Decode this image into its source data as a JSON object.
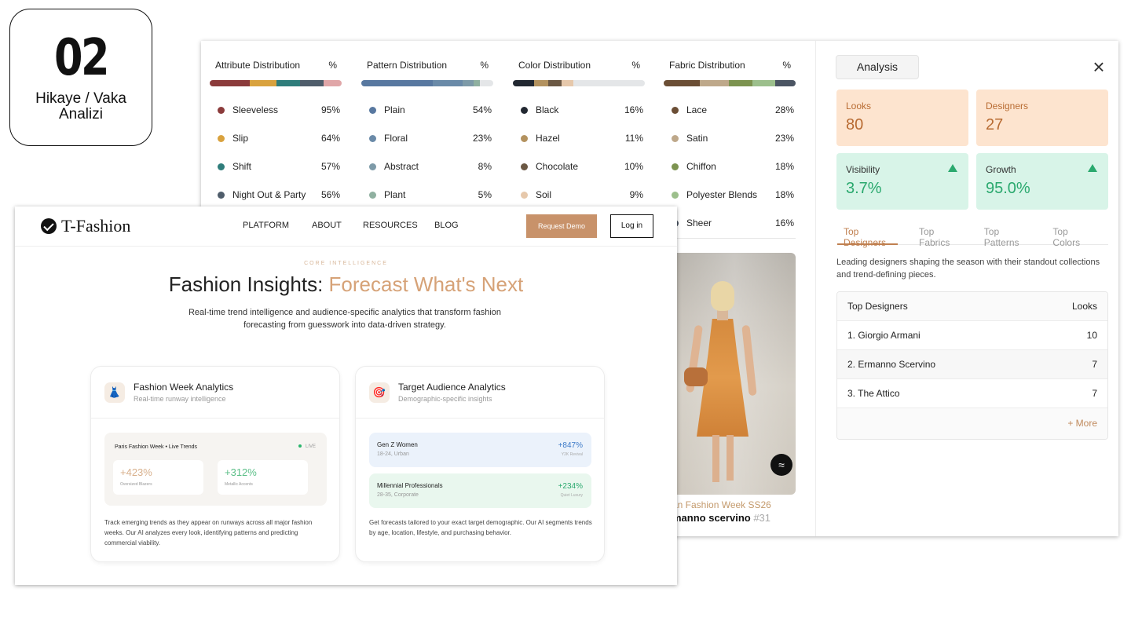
{
  "badge": {
    "number": "02",
    "subtitle_line1": "Hikaye / Vaka",
    "subtitle_line2": "Analizi"
  },
  "distributions": [
    {
      "title": "Attribute Distribution",
      "pct_header": "%",
      "bar": [
        {
          "color": "#8b3b3b",
          "value": 95
        },
        {
          "color": "#d9a23e",
          "value": 64
        },
        {
          "color": "#2f7d7b",
          "value": 57
        },
        {
          "color": "#4f5d6b",
          "value": 56
        },
        {
          "color": "#e0a6a8",
          "value": 44
        }
      ],
      "items": [
        {
          "label": "Sleeveless",
          "pct": "95%",
          "color": "#8b3b3b"
        },
        {
          "label": "Slip",
          "pct": "64%",
          "color": "#d9a23e"
        },
        {
          "label": "Shift",
          "pct": "57%",
          "color": "#2f7d7b"
        },
        {
          "label": "Night Out & Party",
          "pct": "56%",
          "color": "#4f5d6b"
        }
      ]
    },
    {
      "title": "Pattern Distribution",
      "pct_header": "%",
      "bar": [
        {
          "color": "#5878a0",
          "value": 54
        },
        {
          "color": "#6a8aa8",
          "value": 23
        },
        {
          "color": "#7d9aa8",
          "value": 8
        },
        {
          "color": "#8fb0a0",
          "value": 5
        },
        {
          "color": "#e4e6e8",
          "value": 10
        }
      ],
      "items": [
        {
          "label": "Plain",
          "pct": "54%",
          "color": "#5878a0"
        },
        {
          "label": "Floral",
          "pct": "23%",
          "color": "#6a8aa8"
        },
        {
          "label": "Abstract",
          "pct": "8%",
          "color": "#7d9aa8"
        },
        {
          "label": "Plant",
          "pct": "5%",
          "color": "#8fb0a0"
        }
      ]
    },
    {
      "title": "Color Distribution",
      "pct_header": "%",
      "bar": [
        {
          "color": "#222831",
          "value": 16
        },
        {
          "color": "#b3925f",
          "value": 11
        },
        {
          "color": "#6b5844",
          "value": 10
        },
        {
          "color": "#e6c8ab",
          "value": 9
        },
        {
          "color": "#e4e6e8",
          "value": 54
        }
      ],
      "items": [
        {
          "label": "Black",
          "pct": "16%",
          "color": "#222831"
        },
        {
          "label": "Hazel",
          "pct": "11%",
          "color": "#b3925f"
        },
        {
          "label": "Chocolate",
          "pct": "10%",
          "color": "#6b5844"
        },
        {
          "label": "Soil",
          "pct": "9%",
          "color": "#e6c8ab"
        }
      ]
    },
    {
      "title": "Fabric Distribution",
      "pct_header": "%",
      "bar": [
        {
          "color": "#6b4e35",
          "value": 28
        },
        {
          "color": "#bea88a",
          "value": 23
        },
        {
          "color": "#7c9350",
          "value": 18
        },
        {
          "color": "#9cbf8c",
          "value": 18
        },
        {
          "color": "#4b5563",
          "value": 16
        }
      ],
      "items": [
        {
          "label": "Lace",
          "pct": "28%",
          "color": "#6b4e35"
        },
        {
          "label": "Satin",
          "pct": "23%",
          "color": "#bea88a"
        },
        {
          "label": "Chiffon",
          "pct": "18%",
          "color": "#7c9350"
        },
        {
          "label": "Polyester Blends",
          "pct": "18%",
          "color": "#9cbf8c"
        },
        {
          "label": "Sheer",
          "pct": "16%",
          "color": "#4b5563"
        }
      ]
    }
  ],
  "runway": {
    "caption_show": "an Fashion Week SS26",
    "caption_designer": "manno scervino",
    "caption_number": "#31"
  },
  "analysis": {
    "title": "Analysis",
    "close_icon": "close-icon",
    "stats": {
      "looks": {
        "label": "Looks",
        "value": "80"
      },
      "designers": {
        "label": "Designers",
        "value": "27"
      },
      "visibility": {
        "label": "Visibility",
        "value": "3.7%"
      },
      "growth": {
        "label": "Growth",
        "value": "95.0%"
      }
    },
    "tabs": [
      "Top Designers",
      "Top Fabrics",
      "Top Patterns",
      "Top Colors"
    ],
    "active_tab": "Top Designers",
    "lead": "Leading designers shaping the season with their standout collections and trend-defining pieces.",
    "table": {
      "header": {
        "name": "Top Designers",
        "value": "Looks"
      },
      "rows": [
        {
          "name": "1.  Giorgio Armani",
          "value": "10"
        },
        {
          "name": "2.  Ermanno Scervino",
          "value": "7"
        },
        {
          "name": "3.  The Attico",
          "value": "7"
        }
      ],
      "more": "+ More"
    }
  },
  "site": {
    "brand": "T-Fashion",
    "nav": [
      "PLATFORM",
      "ABOUT",
      "RESOURCES",
      "BLOG"
    ],
    "request_demo": "Request Demo",
    "login": "Log in",
    "eyebrow": "CORE INTELLIGENCE",
    "headline_plain": "Fashion Insights: ",
    "headline_accent": "Forecast What's Next",
    "subhead": "Real-time trend intelligence and audience-specific analytics that transform fashion forecasting from guesswork into data-driven strategy.",
    "card1": {
      "title": "Fashion Week Analytics",
      "subtitle": "Real-time runway intelligence",
      "live_title": "Paris Fashion Week • Live Trends",
      "live_label": "LIVE",
      "metrics": [
        {
          "value": "+423%",
          "label": "Oversized Blazers",
          "color": "#d8b08c"
        },
        {
          "value": "+312%",
          "label": "Metallic Accents",
          "color": "#5cbf88"
        }
      ],
      "description": "Track emerging trends as they appear on runways across all major fashion weeks. Our AI analyzes every look, identifying patterns and predicting commercial viability."
    },
    "card2": {
      "title": "Target Audience Analytics",
      "subtitle": "Demographic-specific insights",
      "audiences": [
        {
          "name": "Gen Z Women",
          "demo": "18-24, Urban",
          "value": "+847%",
          "tag": "Y2K Revival",
          "bg": "#ebf2fb",
          "color": "#3d7ac8"
        },
        {
          "name": "Millennial Professionals",
          "demo": "28-35, Corporate",
          "value": "+234%",
          "tag": "Quiet Luxury",
          "bg": "#e9f7ee",
          "color": "#2aa96e"
        }
      ],
      "description": "Get forecasts tailored to your exact target demographic. Our AI segments trends by age, location, lifestyle, and purchasing behavior."
    }
  }
}
